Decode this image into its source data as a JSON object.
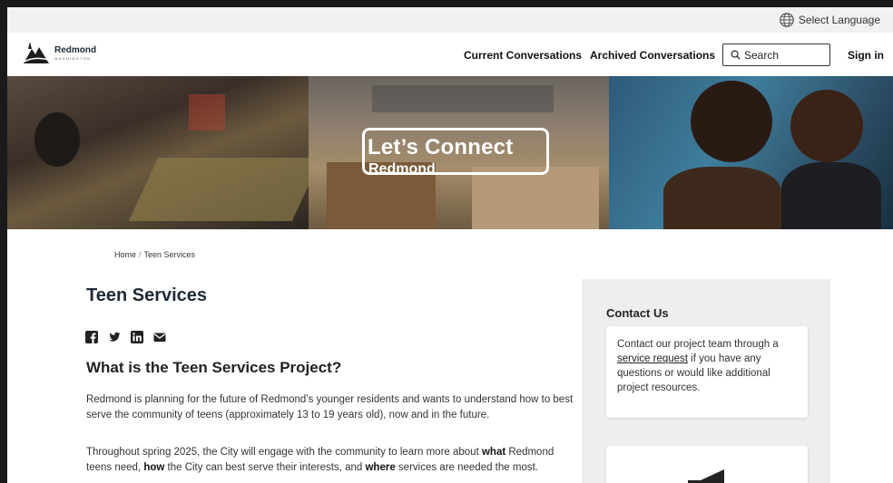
{
  "topbar": {
    "language_label": "Select Language"
  },
  "logo": {
    "name": "Redmond",
    "sub": "WASHINGTON"
  },
  "nav": {
    "current": "Current Conversations",
    "archived": "Archived Conversations",
    "search_placeholder": "Search",
    "signin": "Sign in"
  },
  "hero": {
    "title": "Let’s Connect",
    "subtitle": "Redmond"
  },
  "breadcrumb": {
    "home": "Home",
    "separator": "/",
    "current": "Teen Services"
  },
  "page": {
    "title": "Teen Services",
    "heading": "What is the Teen Services Project?",
    "para1": "Redmond is planning for the future of Redmond’s younger residents and wants to understand how to best serve the community of teens (approximately 13 to 19 years old), now and in the future.",
    "para2_part1": "Throughout spring 2025, the City will engage with the community to learn more about ",
    "para2_what": "what",
    "para2_part2": " Redmond teens need, ",
    "para2_how": "how",
    "para2_part3": " the City can best serve their interests, and ",
    "para2_where": "where",
    "para2_part4": " services are needed the most."
  },
  "share_icons": [
    "facebook-icon",
    "twitter-icon",
    "linkedin-icon",
    "email-icon"
  ],
  "sidebar": {
    "contact_heading": "Contact Us",
    "contact_pre": "Contact our project team through a ",
    "contact_link": "service request",
    "contact_post": " if you have any questions or would like additional project resources."
  },
  "colors": {
    "nav_text": "#111111",
    "sidebar_bg": "#eeeeee",
    "topbar_bg": "#f1f1f1"
  }
}
